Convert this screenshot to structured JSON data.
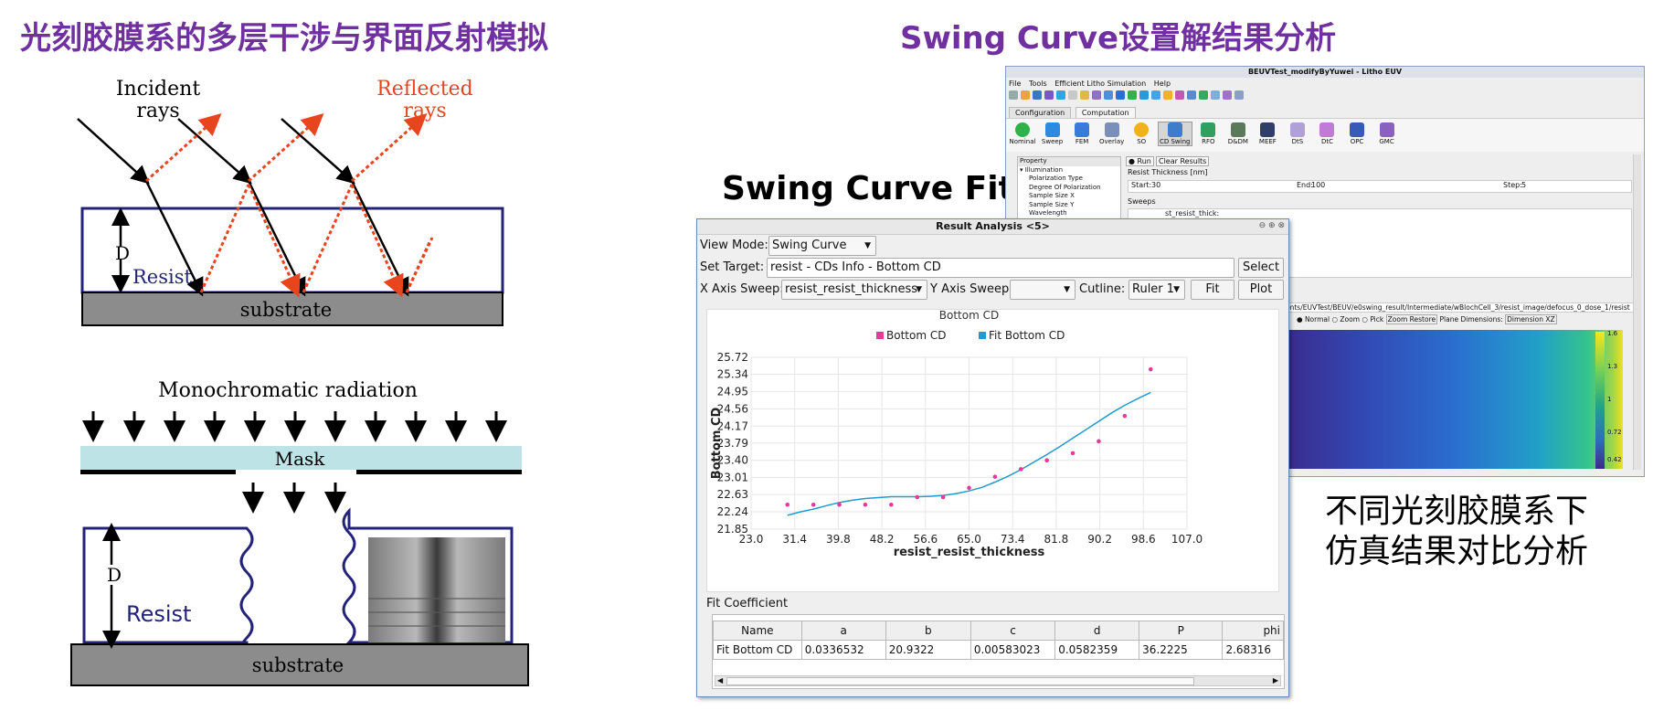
{
  "slide": {
    "left_title": "光刻胶膜系的多层干涉与界面反射模拟",
    "right_title": "Swing Curve设置解结果分析",
    "fit_label": "Swing Curve Fit",
    "note_line1": "不同光刻胶膜系下",
    "note_line2": "仿真结果对比分析"
  },
  "diagram_top": {
    "incident": [
      "Incident",
      "rays"
    ],
    "reflected": [
      "Reflected",
      "rays"
    ],
    "d_label": "D",
    "resist_label": "Resist",
    "substrate_label": "substrate"
  },
  "diagram_bottom": {
    "mono_label": "Monochromatic radiation",
    "mask_label": "Mask",
    "d_label": "D",
    "resist_label": "Resist",
    "substrate_label": "substrate"
  },
  "back_window": {
    "title": "BEUVTest_modifyByYuwei - Litho EUV",
    "menu": [
      "File",
      "Tools",
      "Efficient Litho Simulation",
      "Help"
    ],
    "tabs": [
      "Configuration",
      "Computation"
    ],
    "buttons": [
      "Nominal",
      "Sweep",
      "FEM",
      "Overlay",
      "SO",
      "CD Swing",
      "RFO",
      "D&DM",
      "MEEF",
      "DtS",
      "DtC",
      "OPC",
      "GMC"
    ],
    "property_header": "Property",
    "properties": [
      "▾ Illumination",
      "Polarization Type",
      "Degree Of Polarization",
      "Sample Size X",
      "Sample Size Y",
      "Wavelength"
    ],
    "run_label": "Run",
    "clear_label": "Clear Results",
    "resist_thickness_label": "Resist Thickness [nm]",
    "start_label": "Start:",
    "start_value": "30",
    "end_label": "End:",
    "end_value": "100",
    "step_label": "Step:",
    "step_value": "5",
    "sweeps_label": "Sweeps",
    "sweep_item": "st_resist_thick:",
    "path_text": "ents/EUVTest/BEUV/e0swing_result/Intermediate/wBlochCell_3/resist_image/defocus_0_dose_1/resist",
    "view_opts": [
      "Normal",
      "Zoom",
      "Pick",
      "Zoom Restore",
      "Plane Dimensions:",
      "Dimension XZ"
    ],
    "colorbar_ticks": [
      "1.6",
      "1.3",
      "1",
      "0.72",
      "0.42"
    ]
  },
  "dialog": {
    "title": "Result Analysis <5>",
    "view_mode_label": "View Mode:",
    "view_mode_value": "Swing Curve",
    "set_target_label": "Set Target:",
    "set_target_value": "resist - CDs Info - Bottom CD",
    "select_label": "Select",
    "x_sweep_label": "X Axis Sweep:",
    "x_sweep_value": "resist_resist_thickness",
    "y_sweep_label": "Y Axis Sweep:",
    "y_sweep_value": "",
    "cutline_label": "Cutline:",
    "cutline_value": "Ruler 1",
    "fit_button": "Fit",
    "plot_button": "Plot",
    "fit_coef_label": "Fit Coefficient",
    "table_headers": [
      "Name",
      "a",
      "b",
      "c",
      "d",
      "P",
      "phi"
    ],
    "table_row": [
      "Fit Bottom CD",
      "0.0336532",
      "20.9322",
      "0.00583023",
      "0.0582359",
      "36.2225",
      "2.68316"
    ]
  },
  "chart_data": {
    "type": "scatter",
    "title": "Bottom CD",
    "xlabel": "resist_resist_thickness",
    "ylabel": "Bottom CD",
    "xlim": [
      23.0,
      107.0
    ],
    "ylim": [
      21.85,
      25.72
    ],
    "xticks": [
      "23.0",
      "31.4",
      "39.8",
      "48.2",
      "56.6",
      "65.0",
      "73.4",
      "81.8",
      "90.2",
      "98.6",
      "107.0"
    ],
    "yticks": [
      "25.72",
      "25.34",
      "24.95",
      "24.56",
      "24.17",
      "23.79",
      "23.40",
      "23.01",
      "22.63",
      "22.24",
      "21.85"
    ],
    "grid": true,
    "legend_position": "top-center",
    "colors": {
      "points": "#e6399b",
      "fit": "#1f9bd1"
    },
    "series": [
      {
        "name": "Bottom CD",
        "kind": "points",
        "x": [
          30,
          35,
          40,
          45,
          50,
          55,
          60,
          65,
          70,
          75,
          80,
          85,
          90,
          95,
          100
        ],
        "y": [
          22.4,
          22.4,
          22.4,
          22.4,
          22.4,
          22.57,
          22.57,
          22.78,
          23.03,
          23.2,
          23.4,
          23.56,
          23.83,
          24.4,
          25.45
        ]
      },
      {
        "name": "Fit Bottom CD",
        "kind": "line",
        "x": [
          30,
          32.5,
          35,
          37.5,
          40,
          42.5,
          45,
          47.5,
          50,
          52.5,
          55,
          57.5,
          60,
          62.5,
          65,
          67.5,
          70,
          72.5,
          75,
          77.5,
          80,
          82.5,
          85,
          87.5,
          90,
          92.5,
          95,
          97.5,
          100
        ],
        "y": [
          22.16,
          22.24,
          22.3,
          22.38,
          22.45,
          22.5,
          22.54,
          22.56,
          22.58,
          22.58,
          22.58,
          22.59,
          22.61,
          22.65,
          22.71,
          22.79,
          22.91,
          23.04,
          23.19,
          23.36,
          23.53,
          23.71,
          23.9,
          24.09,
          24.28,
          24.47,
          24.64,
          24.79,
          24.93
        ]
      }
    ]
  }
}
